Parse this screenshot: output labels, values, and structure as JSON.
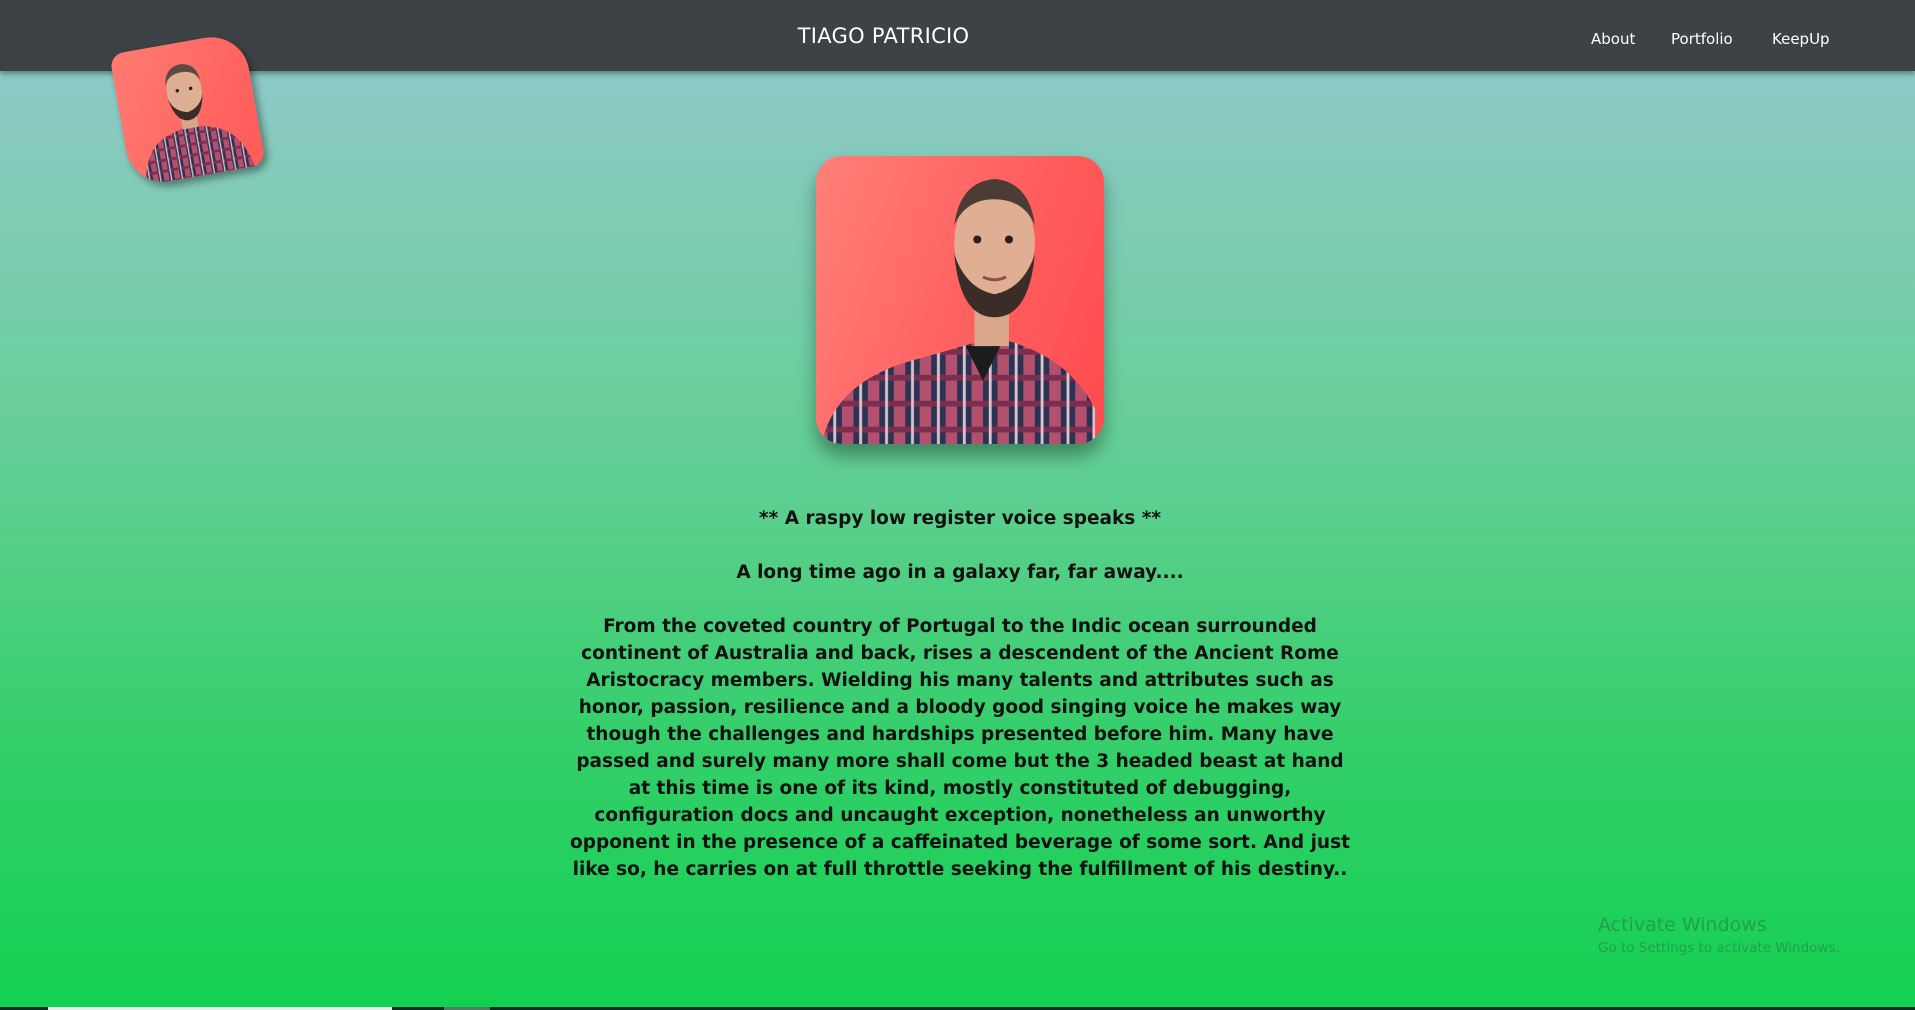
{
  "header": {
    "title": "TIAGO PATRICIO",
    "nav": [
      {
        "label": "About"
      },
      {
        "label": "Portfolio"
      },
      {
        "label": "KeepUp"
      }
    ]
  },
  "images": {
    "logo": "profile-photo-logo",
    "portrait": "profile-photo"
  },
  "intro": {
    "voice": "** A raspy low register voice speaks **",
    "galaxy": "A long time ago in a galaxy far, far away....",
    "story": "From the coveted country of Portugal to the Indic ocean surrounded continent of Australia and back, rises a descendent of the Ancient Rome Aristocracy members. Wielding his many talents and attributes such as honor, passion, resilience and a bloody good singing voice he makes way though the challenges and hardships presented before him. Many have passed and surely many more shall come but the 3 headed beast at hand at this time is one of its kind, mostly constituted of debugging, configuration docs and uncaught exception, nonetheless an unworthy opponent in the presence of a caffeinated beverage of some sort. And just like so, he carries on at full throttle seeking the fulfillment of his destiny.."
  },
  "watermark": {
    "title": "Activate Windows",
    "subtitle": "Go to Settings to activate Windows."
  },
  "colors": {
    "topbar": "#3d4244",
    "gradient_top": "#94c8d0",
    "gradient_bottom": "#13d050",
    "photo_background": "#ff5d5d"
  }
}
